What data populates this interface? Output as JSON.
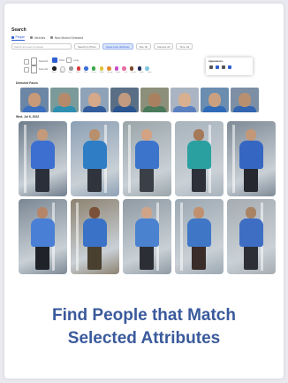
{
  "app": {
    "title": "Search",
    "tabs": [
      {
        "label": "People",
        "active": true
      },
      {
        "label": "Vehicles",
        "active": false
      },
      {
        "label": "New Motion Detected",
        "active": false
      }
    ]
  },
  "filters": {
    "search_placeholder": "Search all recent & upload",
    "chips": [
      {
        "label": "Search by Photo",
        "selected": false
      },
      {
        "label": "Upper-body attributes",
        "selected": true
      },
      {
        "label": "Site: All",
        "selected": false
      },
      {
        "label": "Camera: All",
        "selected": false
      },
      {
        "label": "Time: All",
        "selected": false
      }
    ]
  },
  "attributes": {
    "left_options": [
      "Selected",
      "Face Attr"
    ],
    "middle_options": [
      "Short",
      "Long"
    ],
    "colors": [
      "#222222",
      "#f2f2f2",
      "#9a9a9a",
      "#d93b3b",
      "#3b6fd9",
      "#3aa64a",
      "#e2c43a",
      "#e58a2e",
      "#c64fc6",
      "#e86fa3",
      "#7a4a2a",
      "#1e2a5a",
      "#7fc8e0"
    ],
    "color_labels": [
      "Black",
      "White",
      "Grey",
      "Red",
      "Blue",
      "Green",
      "Yellow",
      "Orange",
      "Purple",
      "Pink",
      "Brown",
      "Navy",
      "Cyan"
    ]
  },
  "popup": {
    "title": "Appearances",
    "icons": [
      "person-icon",
      "bag-icon",
      "car-icon",
      "face-icon"
    ]
  },
  "sections": {
    "faces_label": "Detected Faces",
    "date_label": "Wed, Jul 6, 2022"
  },
  "faces": [
    {
      "bg": "#6c86a5",
      "skin": "#c89a7a",
      "shirt": "#3c6fc0"
    },
    {
      "bg": "#7b9a9a",
      "skin": "#b58a6a",
      "shirt": "#2f8fb0"
    },
    {
      "bg": "#8fa3b8",
      "skin": "#d5a88a",
      "shirt": "#335c9c"
    },
    {
      "bg": "#5a6f85",
      "skin": "#c19a80",
      "shirt": "#2a5590"
    },
    {
      "bg": "#8c8f7a",
      "skin": "#a98060",
      "shirt": "#4a7a5a"
    },
    {
      "bg": "#aab4c2",
      "skin": "#d8b090",
      "shirt": "#5a80c0"
    },
    {
      "bg": "#6a8db0",
      "skin": "#caa080",
      "shirt": "#2f6ab8"
    },
    {
      "bg": "#7c8fa5",
      "skin": "#b89070",
      "shirt": "#3365b0"
    }
  ],
  "results": [
    {
      "bg": "#6f7d8c",
      "shirt": "#3c6fd0",
      "pants": "#2a2f3a",
      "skin": "#c59a7a"
    },
    {
      "bg": "#8da0b5",
      "shirt": "#2f7ec5",
      "pants": "#30343c",
      "skin": "#b8906e"
    },
    {
      "bg": "#9aa5a8",
      "shirt": "#3c74cc",
      "pants": "#3a3f48",
      "skin": "#d2a282"
    },
    {
      "bg": "#a8b3bd",
      "shirt": "#2aa0a0",
      "pants": "#2d3038",
      "skin": "#a57a58"
    },
    {
      "bg": "#7e8a96",
      "shirt": "#3566c2",
      "pants": "#25282f",
      "skin": "#c29878"
    },
    {
      "bg": "#7b8894",
      "shirt": "#4a7fd6",
      "pants": "#1f2329",
      "skin": "#b5856a"
    },
    {
      "bg": "#8c8270",
      "shirt": "#3a72c8",
      "pants": "#4a4030",
      "skin": "#7a5038"
    },
    {
      "bg": "#8f9aa3",
      "shirt": "#4a82d0",
      "pants": "#2b2e35",
      "skin": "#d0a488"
    },
    {
      "bg": "#9ca8b2",
      "shirt": "#3f77c6",
      "pants": "#3a2c28",
      "skin": "#c09070"
    },
    {
      "bg": "#a5acb2",
      "shirt": "#3d6ec4",
      "pants": "#2c2f36",
      "skin": "#a98464"
    }
  ],
  "caption": {
    "line1": "Find People that Match",
    "line2": "Selected Attributes"
  }
}
